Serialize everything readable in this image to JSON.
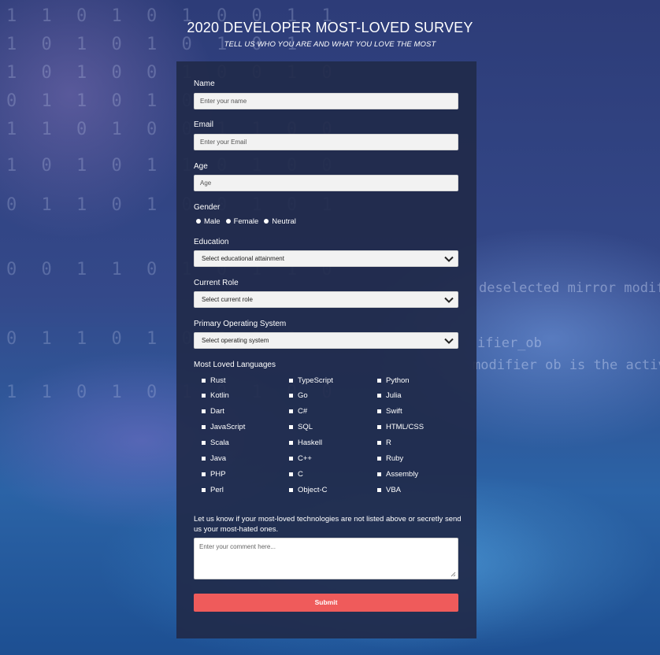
{
  "header": {
    "title": "2020 DEVELOPER MOST-LOVED SURVEY",
    "subtitle": "TELL US WHO YOU ARE AND WHAT YOU LOVE THE MOST"
  },
  "form": {
    "name": {
      "label": "Name",
      "placeholder": "Enter your name"
    },
    "email": {
      "label": "Email",
      "placeholder": "Enter your Email"
    },
    "age": {
      "label": "Age",
      "placeholder": "Age"
    },
    "gender": {
      "label": "Gender",
      "options": [
        "Male",
        "Female",
        "Neutral"
      ]
    },
    "education": {
      "label": "Education",
      "selected": "Select educational attainment"
    },
    "role": {
      "label": "Current Role",
      "selected": "Select current role"
    },
    "os": {
      "label": "Primary Operating System",
      "selected": "Select operating system"
    },
    "languages": {
      "label": "Most Loved Languages",
      "items": [
        "Rust",
        "TypeScript",
        "Python",
        "Kotlin",
        "Go",
        "Julia",
        "Dart",
        "C#",
        "Swift",
        "JavaScript",
        "SQL",
        "HTML/CSS",
        "Scala",
        "Haskell",
        "R",
        "Java",
        "C++",
        "Ruby",
        "PHP",
        "C",
        "Assembly",
        "Perl",
        "Object-C",
        "VBA"
      ]
    },
    "comment": {
      "label": "Let us know if your most-loved technologies are not listed above or secretly send us your most-hated ones.",
      "placeholder": "Enter your comment here..."
    },
    "submit_label": "Submit"
  },
  "colors": {
    "card_bg": "#212a4a",
    "submit_bg": "#ef5b5b",
    "input_bg": "#f2f2f2"
  }
}
